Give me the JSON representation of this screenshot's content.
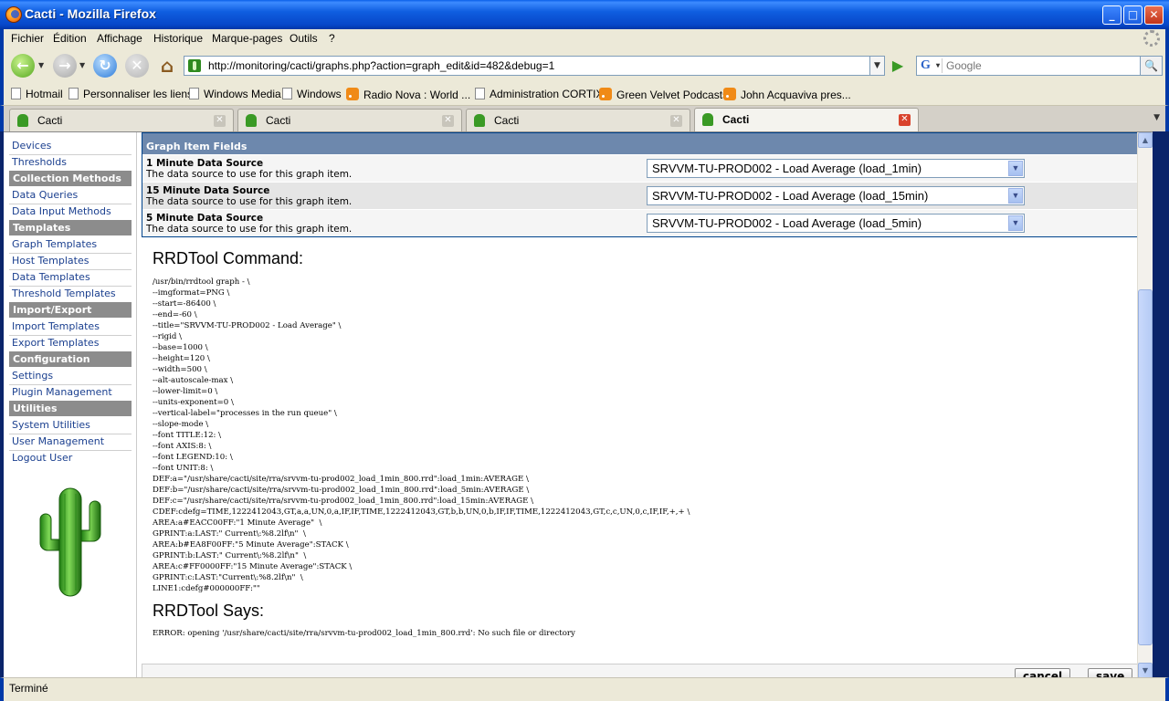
{
  "window": {
    "title": "Cacti - Mozilla Firefox"
  },
  "menu": {
    "items": [
      "Fichier",
      "Édition",
      "Affichage",
      "Historique",
      "Marque-pages",
      "Outils",
      "?"
    ]
  },
  "nav": {
    "url": "http://monitoring/cacti/graphs.php?action=graph_edit&id=482&debug=1",
    "search_placeholder": "Google"
  },
  "bookmarks": [
    {
      "label": "Hotmail",
      "icon": "page-icon"
    },
    {
      "label": "Personnaliser les liens",
      "icon": "page-icon"
    },
    {
      "label": "Windows Media",
      "icon": "page-icon"
    },
    {
      "label": "Windows",
      "icon": "page-icon"
    },
    {
      "label": "Radio Nova : World ...",
      "icon": "rss-icon"
    },
    {
      "label": "Administration CORTIX",
      "icon": "page-icon"
    },
    {
      "label": "Green Velvet Podcasts",
      "icon": "rss-icon"
    },
    {
      "label": "John Acquaviva pres...",
      "icon": "rss-icon"
    }
  ],
  "tabs": [
    {
      "label": "Cacti",
      "active": false
    },
    {
      "label": "Cacti",
      "active": false
    },
    {
      "label": "Cacti",
      "active": false
    },
    {
      "label": "Cacti",
      "active": true
    }
  ],
  "sidebar": {
    "top_links": [
      "Devices",
      "Thresholds"
    ],
    "sections": [
      {
        "heading": "Collection Methods",
        "links": [
          "Data Queries",
          "Data Input Methods"
        ]
      },
      {
        "heading": "Templates",
        "links": [
          "Graph Templates",
          "Host Templates",
          "Data Templates",
          "Threshold Templates"
        ]
      },
      {
        "heading": "Import/Export",
        "links": [
          "Import Templates",
          "Export Templates"
        ]
      },
      {
        "heading": "Configuration",
        "links": [
          "Settings",
          "Plugin Management"
        ]
      },
      {
        "heading": "Utilities",
        "links": [
          "System Utilities",
          "User Management",
          "Logout User"
        ]
      }
    ]
  },
  "item_fields": {
    "header": "Graph Item Fields",
    "rows": [
      {
        "name": "1 Minute Data Source",
        "desc": "The data source to use for this graph item.",
        "value": "SRVVM-TU-PROD002 - Load Average (load_1min)"
      },
      {
        "name": "15 Minute Data Source",
        "desc": "The data source to use for this graph item.",
        "value": "SRVVM-TU-PROD002 - Load Average (load_15min)"
      },
      {
        "name": "5 Minute Data Source",
        "desc": "The data source to use for this graph item.",
        "value": "SRVVM-TU-PROD002 - Load Average (load_5min)"
      }
    ]
  },
  "rrd": {
    "command_title": "RRDTool Command:",
    "command_lines": [
      "/usr/bin/rrdtool graph - \\",
      "--imgformat=PNG \\",
      "--start=-86400 \\",
      "--end=-60 \\",
      "--title=\"SRVVM-TU-PROD002 - Load Average\" \\",
      "--rigid \\",
      "--base=1000 \\",
      "--height=120 \\",
      "--width=500 \\",
      "--alt-autoscale-max \\",
      "--lower-limit=0 \\",
      "--units-exponent=0 \\",
      "--vertical-label=\"processes in the run queue\" \\",
      "--slope-mode \\",
      "--font TITLE:12: \\",
      "--font AXIS:8: \\",
      "--font LEGEND:10: \\",
      "--font UNIT:8: \\",
      "DEF:a=\"/usr/share/cacti/site/rra/srvvm-tu-prod002_load_1min_800.rrd\":load_1min:AVERAGE \\",
      "DEF:b=\"/usr/share/cacti/site/rra/srvvm-tu-prod002_load_1min_800.rrd\":load_5min:AVERAGE \\",
      "DEF:c=\"/usr/share/cacti/site/rra/srvvm-tu-prod002_load_1min_800.rrd\":load_15min:AVERAGE \\",
      "CDEF:cdefg=TIME,1222412043,GT,a,a,UN,0,a,IF,IF,TIME,1222412043,GT,b,b,UN,0,b,IF,IF,TIME,1222412043,GT,c,c,UN,0,c,IF,IF,+,+ \\",
      "AREA:a#EACC00FF:\"1 Minute Average\"  \\",
      "GPRINT:a:LAST:\" Current\\:%8.2lf\\n\"  \\",
      "AREA:b#EA8F00FF:\"5 Minute Average\":STACK \\",
      "GPRINT:b:LAST:\" Current\\:%8.2lf\\n\"  \\",
      "AREA:c#FF0000FF:\"15 Minute Average\":STACK \\",
      "GPRINT:c:LAST:\"Current\\:%8.2lf\\n\"  \\",
      "LINE1:cdefg#000000FF:\"\""
    ],
    "says_title": "RRDTool Says:",
    "error": "ERROR: opening '/usr/share/cacti/site/rra/srvvm-tu-prod002_load_1min_800.rrd': No such file or directory"
  },
  "buttons": {
    "cancel": "cancel",
    "save": "save"
  },
  "status": {
    "text": "Terminé"
  },
  "colors": {
    "header_blue": "#6d88ad",
    "sidebar_heading": "#8c8c8c",
    "link": "#1a3f8f",
    "titlebar": "#0747c9"
  }
}
